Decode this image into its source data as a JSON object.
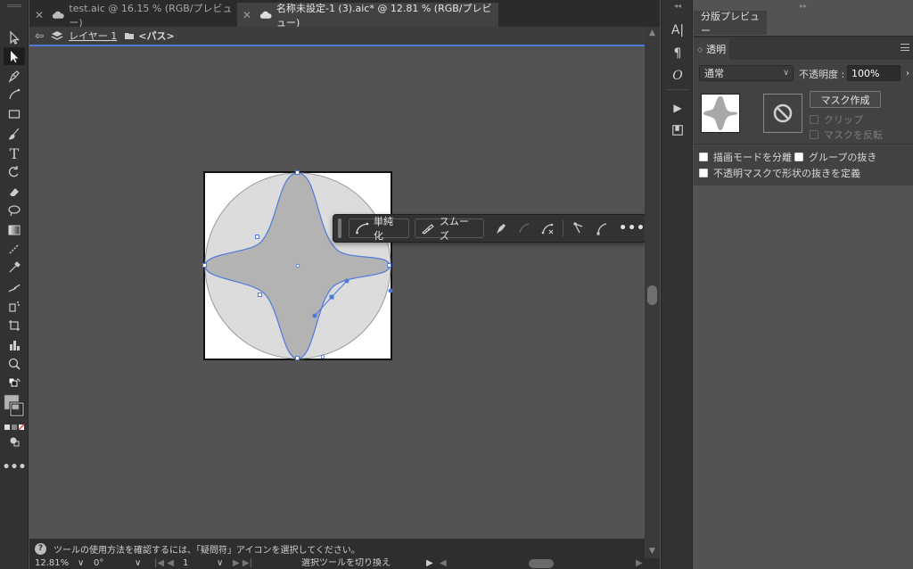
{
  "tabs": [
    {
      "title": "test.aic @ 16.15 % (RGB/プレビュー)",
      "active": false
    },
    {
      "title": "名称未設定-1 (3).aic* @ 12.81 % (RGB/プレビュー)",
      "active": true
    }
  ],
  "breadcrumb": {
    "layer": "レイヤー 1",
    "current": "<パス>"
  },
  "taskbar": {
    "simplify_label": "単純化",
    "smooth_label": "スムーズ"
  },
  "help": {
    "icon": "?",
    "text": "ツールの使用方法を確認するには、「疑問符」アイコンを選択してください。"
  },
  "status": {
    "zoom": "12.81%",
    "rotation": "0°",
    "artboard": "1",
    "tool_hint": "選択ツールを切り換え"
  },
  "right_panel": {
    "top_tab": "分版プレビュー",
    "panel_tab": "透明",
    "blend_mode": "通常",
    "opacity_label": "不透明度 :",
    "opacity_value": "100%",
    "mask_button": "マスク作成",
    "clip_label": "クリップ",
    "invert_label": "マスクを反転",
    "isolate_label": "描画モードを分離",
    "knockout_label": "グループの抜き",
    "opacity_mask_label": "不透明マスクで形状の抜きを定義"
  },
  "strip_icons": [
    "character-icon",
    "paragraph-icon",
    "opentype-icon",
    "actions-icon",
    "libraries-icon"
  ],
  "colors": {
    "selection": "#4c7bd9",
    "shape_fill": "#b3b3b3",
    "circle_fill": "#dcdcdc"
  }
}
